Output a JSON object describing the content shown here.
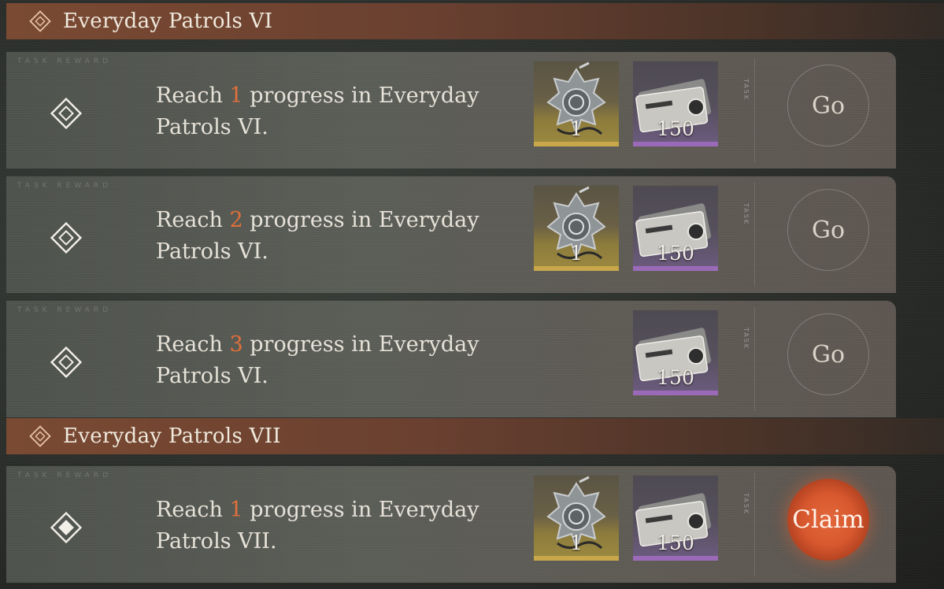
{
  "sections": [
    {
      "title": "Everyday Patrols VI",
      "tasks": [
        {
          "watermark": "TASK REWARD",
          "desc_pre": "Reach ",
          "desc_num": "1",
          "desc_post": " progress in Everyday Patrols VI.",
          "rewards": [
            {
              "kind": "badge",
              "rarity": "gold",
              "qty": "1"
            },
            {
              "kind": "security-ticket",
              "rarity": "purple",
              "qty": "150"
            }
          ],
          "side_label": "TASK",
          "action": "Go"
        },
        {
          "watermark": "TASK REWARD",
          "desc_pre": "Reach ",
          "desc_num": "2",
          "desc_post": " progress in Everyday Patrols VI.",
          "rewards": [
            {
              "kind": "badge",
              "rarity": "gold",
              "qty": "1"
            },
            {
              "kind": "security-ticket",
              "rarity": "purple",
              "qty": "150"
            }
          ],
          "side_label": "TASK",
          "action": "Go"
        },
        {
          "watermark": "TASK REWARD",
          "desc_pre": "Reach ",
          "desc_num": "3",
          "desc_post": " progress in Everyday Patrols VI.",
          "rewards": [
            {
              "kind": "security-ticket",
              "rarity": "purple",
              "qty": "150"
            }
          ],
          "side_label": "TASK",
          "action": "Go"
        }
      ]
    },
    {
      "title": "Everyday Patrols VII",
      "tasks": [
        {
          "watermark": "TASK REWARD",
          "desc_pre": "Reach ",
          "desc_num": "1",
          "desc_post": " progress in Everyday Patrols VII.",
          "rewards": [
            {
              "kind": "badge",
              "rarity": "gold",
              "qty": "1"
            },
            {
              "kind": "security-ticket",
              "rarity": "purple",
              "qty": "150"
            }
          ],
          "side_label": "TASK",
          "action": "Claim"
        }
      ]
    }
  ],
  "icons": {
    "section": "diamond-outline-icon",
    "task_incomplete": "diamond-outline-icon",
    "task_complete": "diamond-filled-icon"
  },
  "colors": {
    "accent_number": "#e0703a",
    "claim_button": "#d8582e",
    "gold_rarity": "#c8a84a",
    "purple_rarity": "#9a6ab8",
    "section_header": "#7a4a32"
  }
}
